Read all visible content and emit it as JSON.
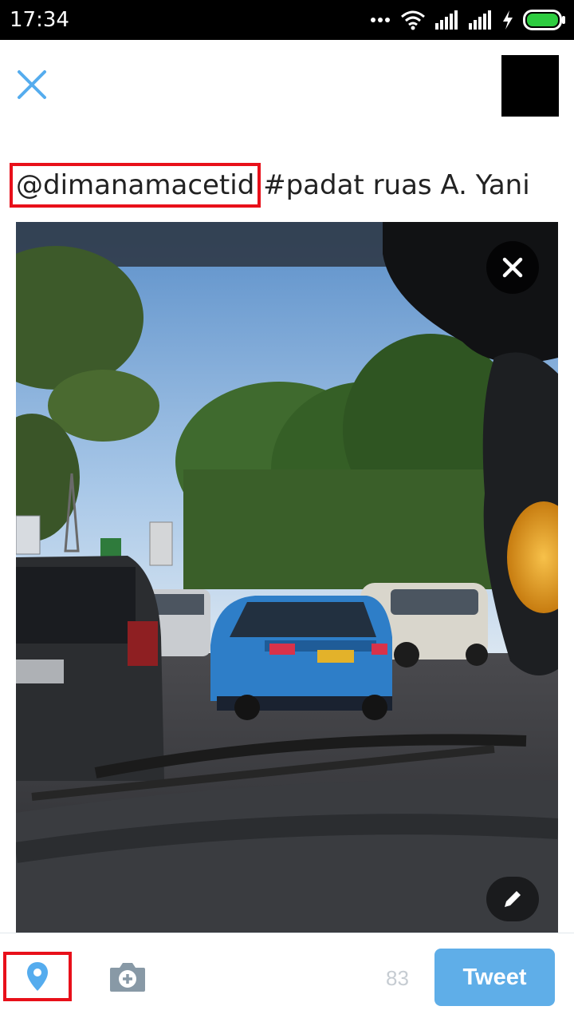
{
  "status_bar": {
    "time": "17:34",
    "icons": [
      "more-icon",
      "wifi-icon",
      "signal-icon",
      "signal-icon",
      "charging-icon",
      "battery-icon"
    ],
    "battery_color": "#2ecc40"
  },
  "composer": {
    "close_icon": "close-icon",
    "accent_color": "#55acee",
    "text_mention": "@dimanamacetid",
    "text_rest": " #padat ruas A. Yani"
  },
  "photo": {
    "remove_icon": "close-icon",
    "edit_icon": "pencil-icon"
  },
  "toolbar": {
    "location_icon": "location-pin-icon",
    "camera_icon": "add-photo-icon",
    "char_count": "83",
    "tweet_label": "Tweet"
  },
  "highlight_color": "#e8101a"
}
